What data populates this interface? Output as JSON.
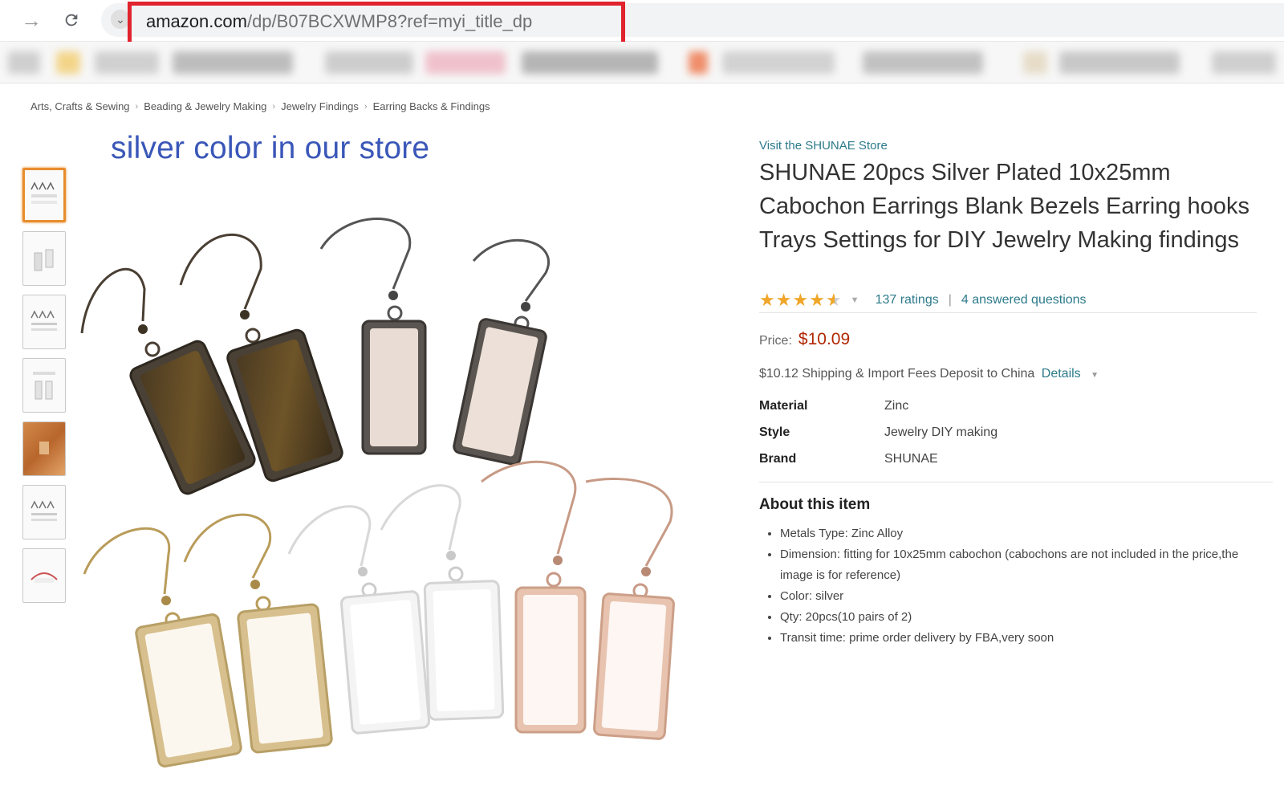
{
  "browser": {
    "url_domain": "amazon.com",
    "url_path": "/dp/B07BCXWMP8?ref=myi_title_dp"
  },
  "breadcrumb": [
    "Arts, Crafts & Sewing",
    "Beading & Jewelry Making",
    "Jewelry Findings",
    "Earring Backs & Findings"
  ],
  "image_caption": "silver color in our store",
  "product": {
    "store_link": "Visit the SHUNAE Store",
    "title": "SHUNAE 20pcs Silver Plated 10x25mm Cabochon Earrings Blank Bezels Earring hooks Trays Settings for DIY Jewelry Making findings",
    "rating_stars": 4.5,
    "ratings_count": "137 ratings",
    "answered_questions": "4 answered questions",
    "price_label": "Price:",
    "price": "$10.09",
    "shipping_text": "$10.12 Shipping & Import Fees Deposit to China",
    "shipping_details": "Details"
  },
  "specs": [
    {
      "label": "Material",
      "value": "Zinc"
    },
    {
      "label": "Style",
      "value": "Jewelry DIY making"
    },
    {
      "label": "Brand",
      "value": "SHUNAE"
    }
  ],
  "about": {
    "title": "About this item",
    "bullets": [
      "Metals Type: Zinc Alloy",
      "Dimension: fitting for 10x25mm cabochon (cabochons are not included in the price,the image is for reference)",
      "Color: silver",
      "Qty: 20pcs(10 pairs of 2)",
      "Transit time: prime order delivery by FBA,very soon"
    ]
  },
  "colors": {
    "accent_link": "#2d7a8a",
    "price": "#b12704",
    "star": "#f0a629",
    "url_highlight": "#e0232e",
    "caption": "#3a57b8",
    "thumb_selected": "#e78d2f"
  }
}
